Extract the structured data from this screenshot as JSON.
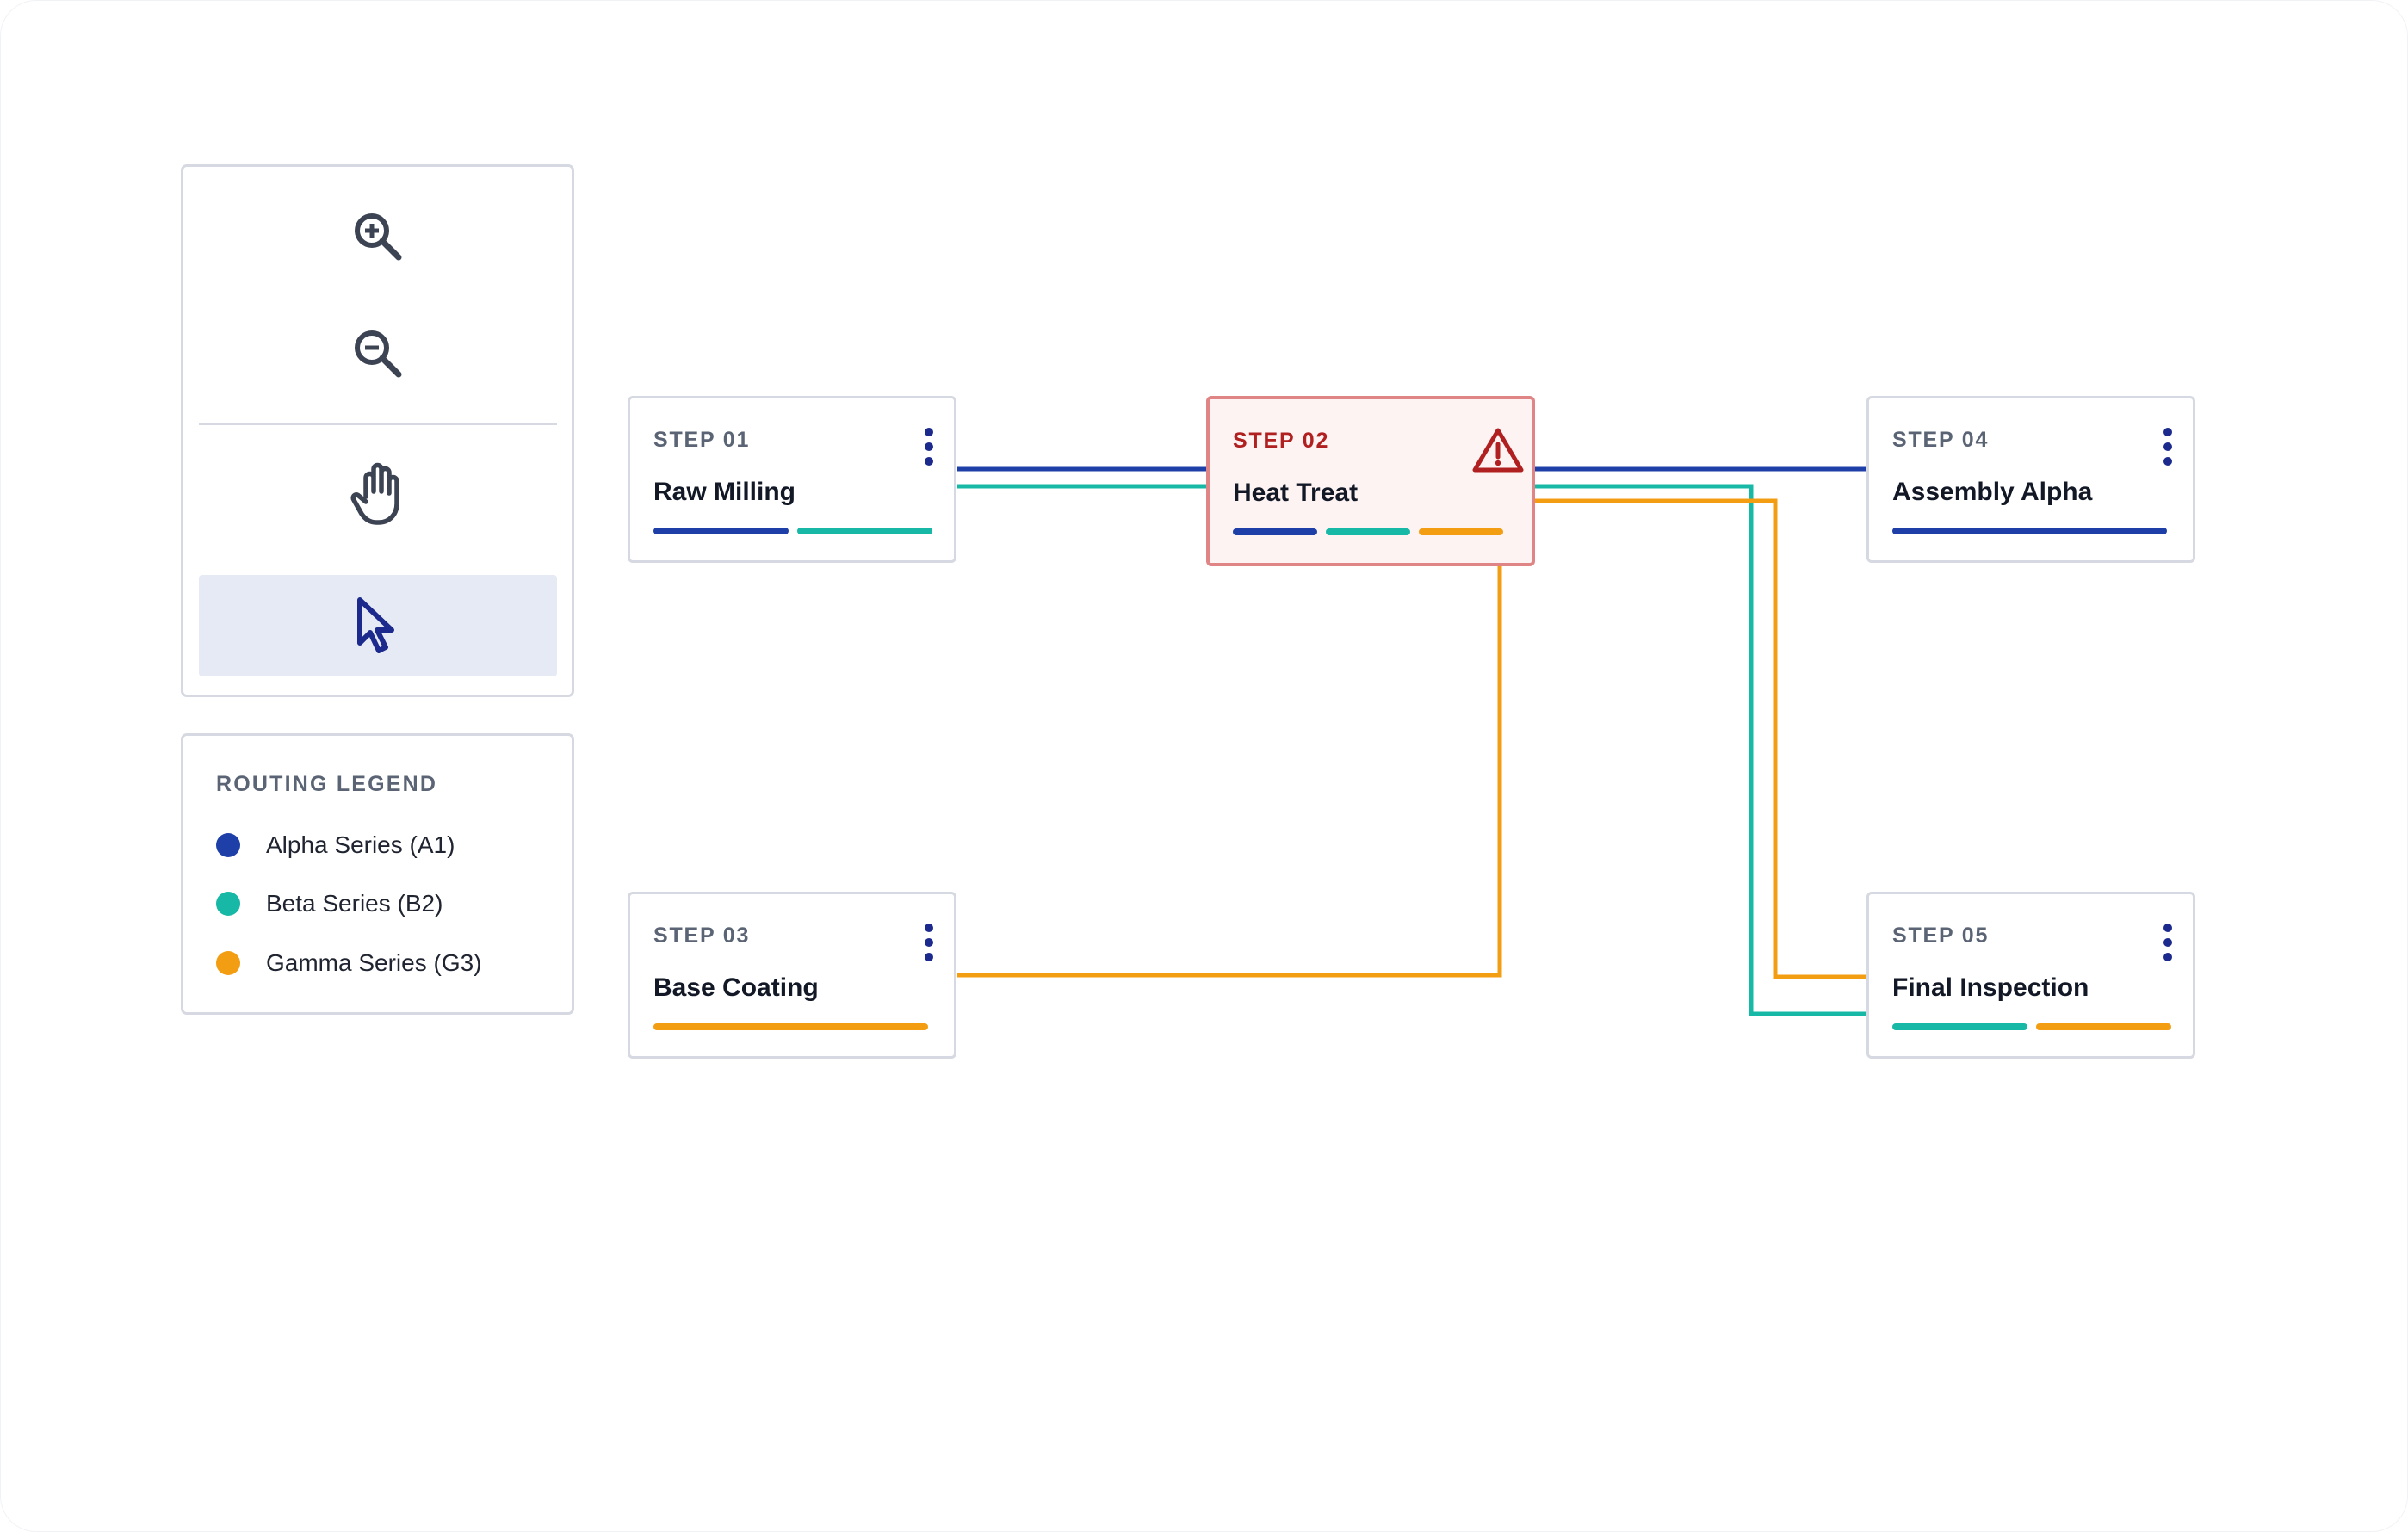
{
  "colors": {
    "alpha": "#1f3fa8",
    "beta": "#17b8a6",
    "gamma": "#f29d12",
    "alert_border": "#e08585",
    "alert_text": "#b02020",
    "active_tool_bg": "#e6eaf4",
    "border": "#d6d9e1"
  },
  "toolbar": {
    "tools": [
      {
        "icon": "zoom-in-icon",
        "active": false
      },
      {
        "icon": "zoom-out-icon",
        "active": false
      },
      {
        "icon": "hand-pan-icon",
        "active": false
      },
      {
        "icon": "pointer-select-icon",
        "active": true
      }
    ]
  },
  "legend": {
    "title": "ROUTING LEGEND",
    "items": [
      {
        "label": "Alpha Series (A1)",
        "color_key": "alpha"
      },
      {
        "label": "Beta Series (B2)",
        "color_key": "beta"
      },
      {
        "label": "Gamma Series (G3)",
        "color_key": "gamma"
      }
    ]
  },
  "steps": [
    {
      "step": "STEP 01",
      "name": "Raw Milling",
      "routes": [
        "alpha",
        "beta"
      ],
      "alert": false
    },
    {
      "step": "STEP 02",
      "name": "Heat Treat",
      "routes": [
        "alpha",
        "beta",
        "gamma"
      ],
      "alert": true,
      "alert_icon": "warning-triangle-icon"
    },
    {
      "step": "STEP 03",
      "name": "Base Coating",
      "routes": [
        "gamma"
      ],
      "alert": false
    },
    {
      "step": "STEP 04",
      "name": "Assembly Alpha",
      "routes": [
        "alpha"
      ],
      "alert": false
    },
    {
      "step": "STEP 05",
      "name": "Final Inspection",
      "routes": [
        "beta",
        "gamma"
      ],
      "alert": false
    }
  ],
  "connections": [
    {
      "from": "STEP 01",
      "to": "STEP 02",
      "route": "alpha"
    },
    {
      "from": "STEP 01",
      "to": "STEP 02",
      "route": "beta"
    },
    {
      "from": "STEP 02",
      "to": "STEP 04",
      "route": "alpha"
    },
    {
      "from": "STEP 02",
      "to": "STEP 05",
      "route": "beta"
    },
    {
      "from": "STEP 02",
      "to": "STEP 05",
      "route": "gamma"
    },
    {
      "from": "STEP 03",
      "to": "STEP 02",
      "route": "gamma"
    }
  ]
}
